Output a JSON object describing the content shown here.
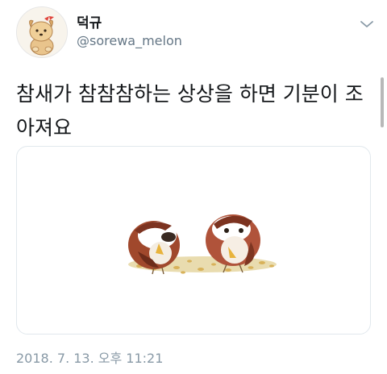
{
  "tweet": {
    "author": {
      "display_name": "덕규",
      "handle": "@sorewa_melon",
      "avatar_icon": "dog-avatar-icon"
    },
    "menu_icon": "chevron-down-icon",
    "text": "참새가 참참참하는 상상을 하면 기분이 조아져요",
    "media_icon": "sparrows-illustration",
    "timestamp": "2018. 7. 13. 오후 11:21"
  },
  "colors": {
    "text_primary": "#14171a",
    "text_secondary": "#657786",
    "timestamp": "#8899a6",
    "card_border": "#e1e8ed"
  }
}
